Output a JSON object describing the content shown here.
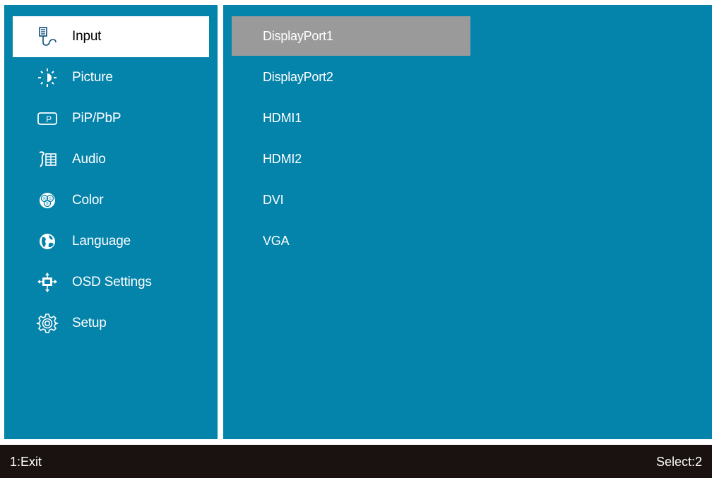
{
  "colors": {
    "panel_bg": "#0483ab",
    "selected_bg": "#ffffff",
    "highlight_bg": "#9a9a9a",
    "footer_bg": "#1a1210",
    "text": "#ffffff"
  },
  "menu": {
    "selected": "Input",
    "items": [
      {
        "label": "Input",
        "icon": "input-connector-icon"
      },
      {
        "label": "Picture",
        "icon": "brightness-icon"
      },
      {
        "label": "PiP/PbP",
        "icon": "pip-icon"
      },
      {
        "label": "Audio",
        "icon": "audio-icon"
      },
      {
        "label": "Color",
        "icon": "rgb-color-icon"
      },
      {
        "label": "Language",
        "icon": "globe-icon"
      },
      {
        "label": "OSD Settings",
        "icon": "osd-settings-icon"
      },
      {
        "label": "Setup",
        "icon": "gear-icon"
      }
    ]
  },
  "options": {
    "highlighted": "DisplayPort1",
    "items": [
      "DisplayPort1",
      "DisplayPort2",
      "HDMI1",
      "HDMI2",
      "DVI",
      "VGA"
    ]
  },
  "footer": {
    "left": "1:Exit",
    "right": "Select:2"
  }
}
